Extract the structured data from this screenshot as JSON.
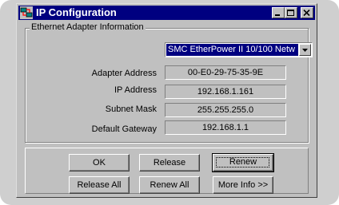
{
  "window": {
    "title": "IP Configuration"
  },
  "adapter_info": {
    "group_label": "Ethernet  Adapter Information",
    "adapter_select": {
      "selected": "SMC EtherPower II 10/100 Netw"
    },
    "fields": [
      {
        "label": "Adapter Address",
        "value": "00-E0-29-75-35-9E"
      },
      {
        "label": "IP Address",
        "value": "192.168.1.161"
      },
      {
        "label": "Subnet Mask",
        "value": "255.255.255.0"
      },
      {
        "label": "Default Gateway",
        "value": "192.168.1.1"
      }
    ]
  },
  "buttons": {
    "ok": "OK",
    "release": "Release",
    "renew": "Renew",
    "release_all": "Release All",
    "renew_all": "Renew All",
    "more_info": "More Info >>"
  },
  "icons": {
    "app": "network-config-icon",
    "minimize": "minimize-icon",
    "maximize": "maximize-icon",
    "close": "close-icon",
    "dropdown": "chevron-down-icon"
  },
  "colors": {
    "titlebar": "#000080",
    "face": "#c0c0c0",
    "selection": "#000080"
  }
}
